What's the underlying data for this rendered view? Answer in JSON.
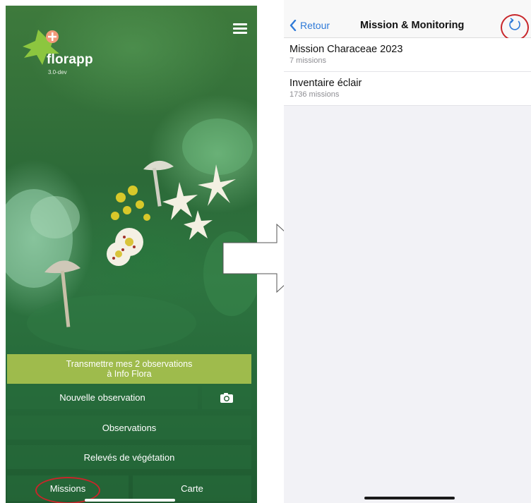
{
  "left_screen": {
    "app_name": "florapp",
    "app_version": "3.0-dev",
    "buttons": {
      "transmit_line1": "Transmettre mes 2 observations",
      "transmit_line2": "à Info Flora",
      "new_observation": "Nouvelle observation",
      "observations": "Observations",
      "releves": "Relevés de végétation",
      "missions": "Missions",
      "carte": "Carte"
    },
    "icons": {
      "menu": "hamburger-menu-icon",
      "camera": "camera-icon",
      "logo": "florapp-leaf-logo"
    }
  },
  "right_screen": {
    "nav": {
      "back_label": "Retour",
      "title": "Mission & Monitoring"
    },
    "missions": [
      {
        "name": "Mission Characeae 2023",
        "count": "7 missions"
      },
      {
        "name": "Inventaire éclair",
        "count": "1736 missions"
      }
    ],
    "icons": {
      "back": "chevron-left-icon",
      "refresh": "refresh-icon"
    }
  },
  "colors": {
    "ios_blue": "#2f7ad8",
    "highlight_red": "#c8262a",
    "transmit_yellow_green": "#b9cd50",
    "forest_green": "#2c6a38"
  }
}
